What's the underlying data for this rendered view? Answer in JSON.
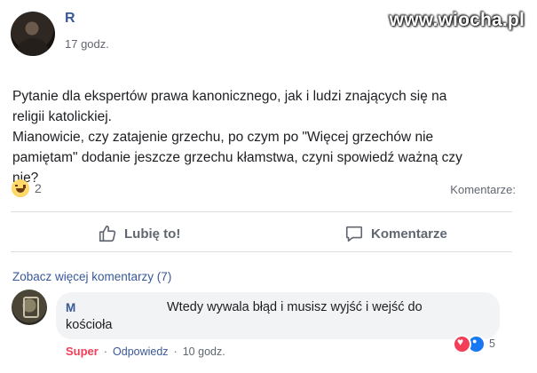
{
  "post": {
    "author": "R",
    "timestamp": "17 godz.",
    "text_lines": [
      "Pytanie dla ekspertów prawa kanonicznego, jak i ludzi znających się na",
      "religii katolickiej.",
      "Mianowicie, czy zatajenie grzechu, po czym po \"Więcej grzechów nie",
      "pamiętam\" dodanie jeszcze grzechu kłamstwa, czyni spowiedź ważną czy",
      "nie?"
    ],
    "reaction_icon": "haha-emoji-icon",
    "reaction_count": "2",
    "comments_count_label": "Komentarze:"
  },
  "watermark": "www.wiocha.pl",
  "actions": {
    "like_label": "Lubię to!",
    "like_icon": "thumbs-up-icon",
    "comment_label": "Komentarze",
    "comment_icon": "speech-bubble-icon"
  },
  "comments": {
    "more_link": "Zobacz więcej komentarzy (7)",
    "items": [
      {
        "author": "M",
        "text_line_1": "Wtedy wywala błąd i musisz wyjść i wejść do",
        "text_line_2": "kościoła",
        "reaction_count": "5",
        "reaction_label": "Super",
        "reply_label": "Odpowiedz",
        "time": "10 godz."
      }
    ]
  },
  "colors": {
    "link_blue": "#385898",
    "meta_gray": "#606770",
    "bubble_bg": "#f2f3f5",
    "love_red": "#f33e58",
    "like_blue": "#1877f2"
  }
}
